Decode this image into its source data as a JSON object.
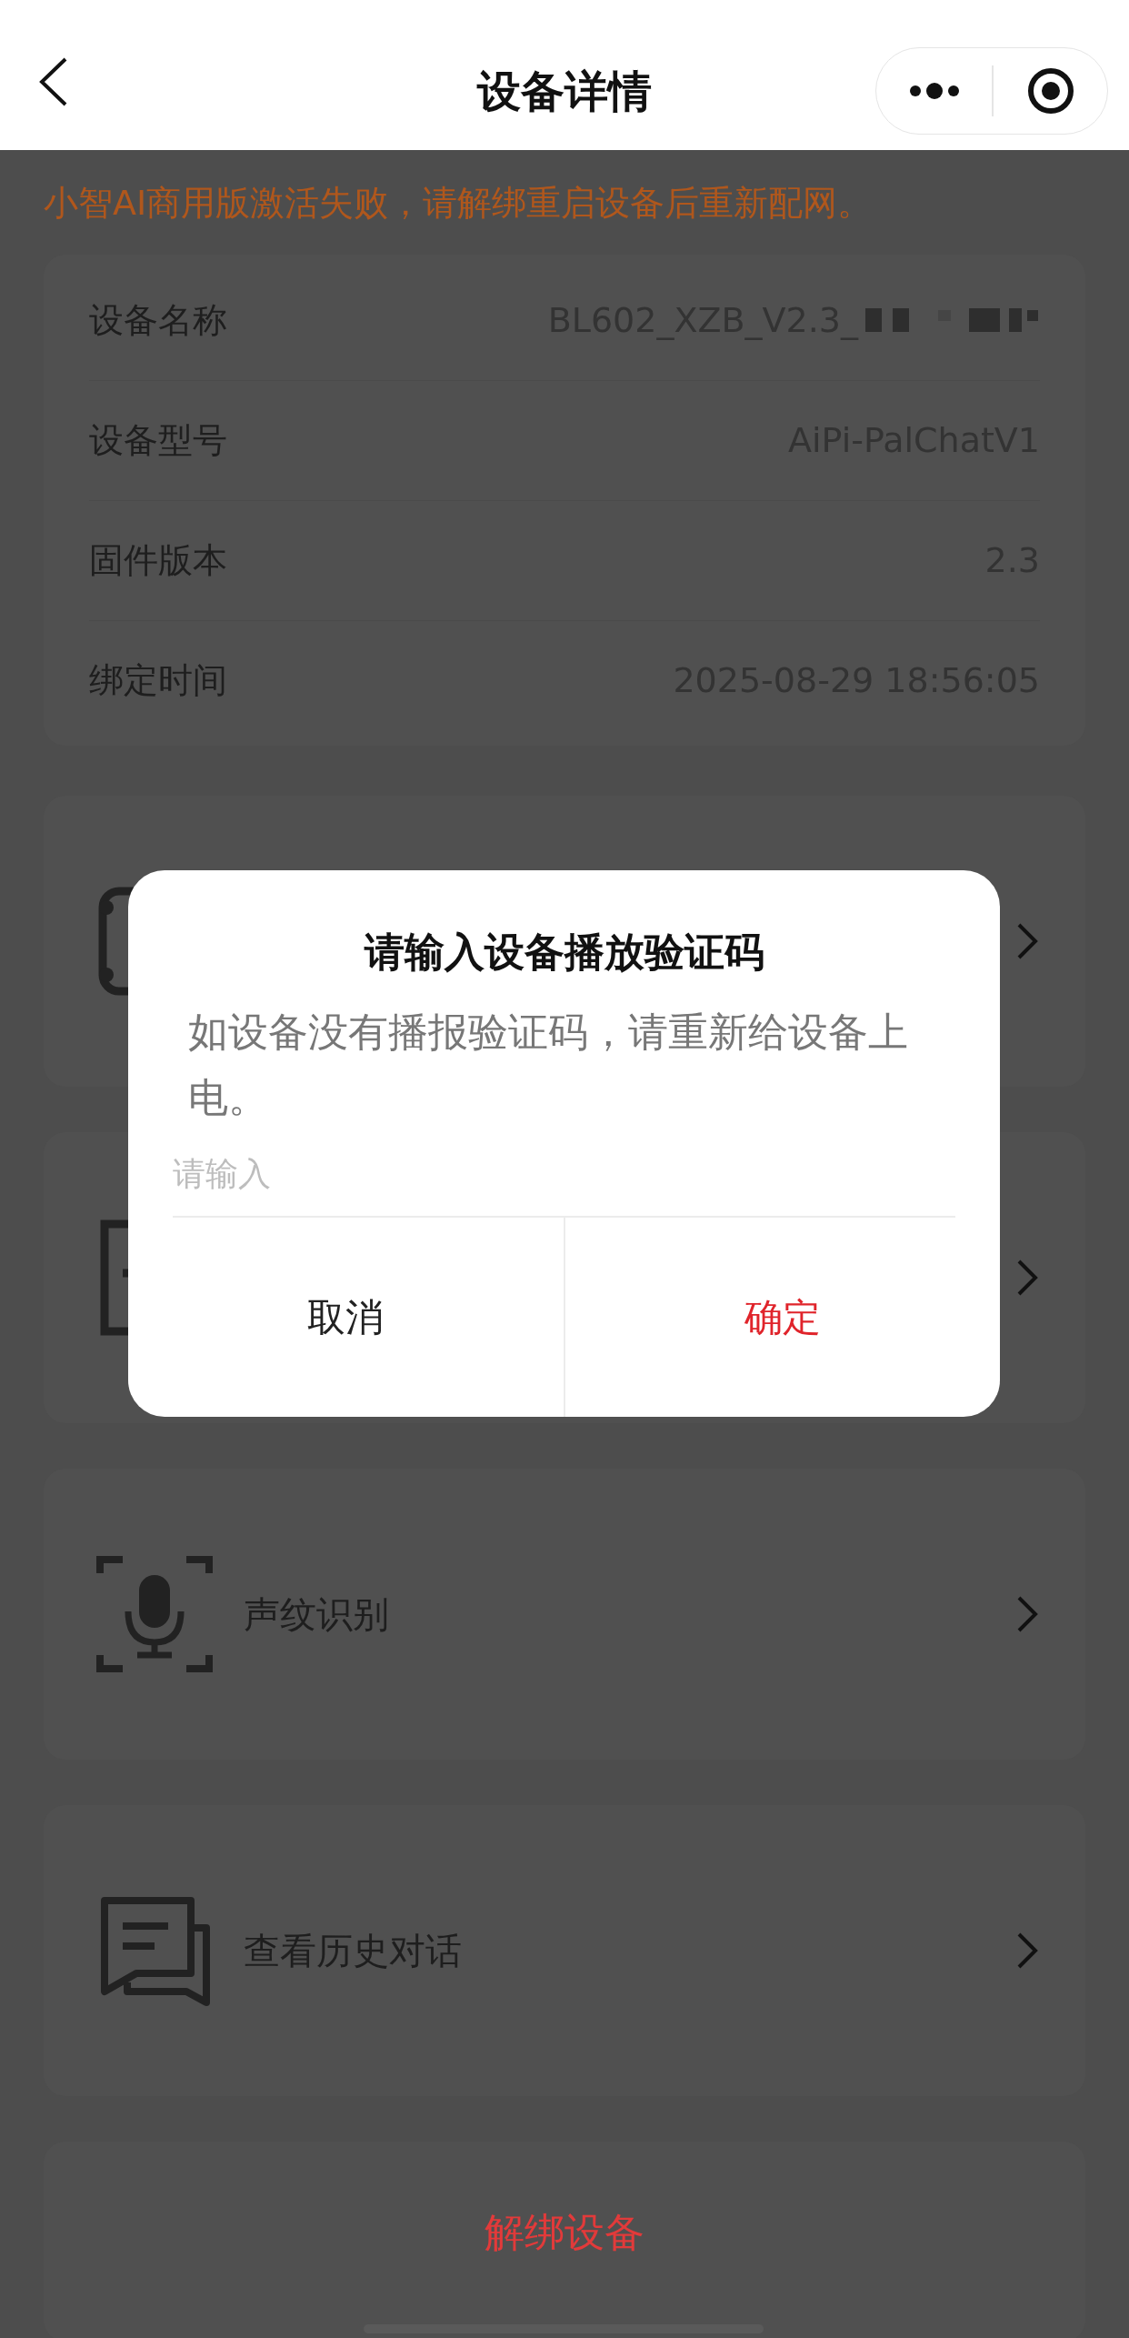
{
  "nav": {
    "title": "设备详情"
  },
  "banner": "小智AI商用版激活失败，请解绑重启设备后重新配网。",
  "info_rows": [
    {
      "label": "设备名称",
      "value": "BL602_XZB_V2.3_",
      "redacted": true
    },
    {
      "label": "设备型号",
      "value": "AiPi-PalChatV1",
      "redacted": false
    },
    {
      "label": "固件版本",
      "value": "2.3",
      "redacted": false
    },
    {
      "label": "绑定时间",
      "value": "2025-08-29 18:56:05",
      "redacted": false
    }
  ],
  "menu_items": [
    {
      "kind": "device"
    },
    {
      "kind": "document"
    },
    {
      "kind": "voiceprint",
      "label": "声纹识别"
    },
    {
      "kind": "history",
      "label": "查看历史对话"
    }
  ],
  "unbind_button": "解绑设备",
  "dialog": {
    "title": "请输入设备播放验证码",
    "message": "如设备没有播报验证码，请重新给设备上电。",
    "placeholder": "请输入",
    "buttons": [
      {
        "label": "取消",
        "kind": "cancel"
      },
      {
        "label": "确定",
        "kind": "confirm"
      }
    ]
  }
}
